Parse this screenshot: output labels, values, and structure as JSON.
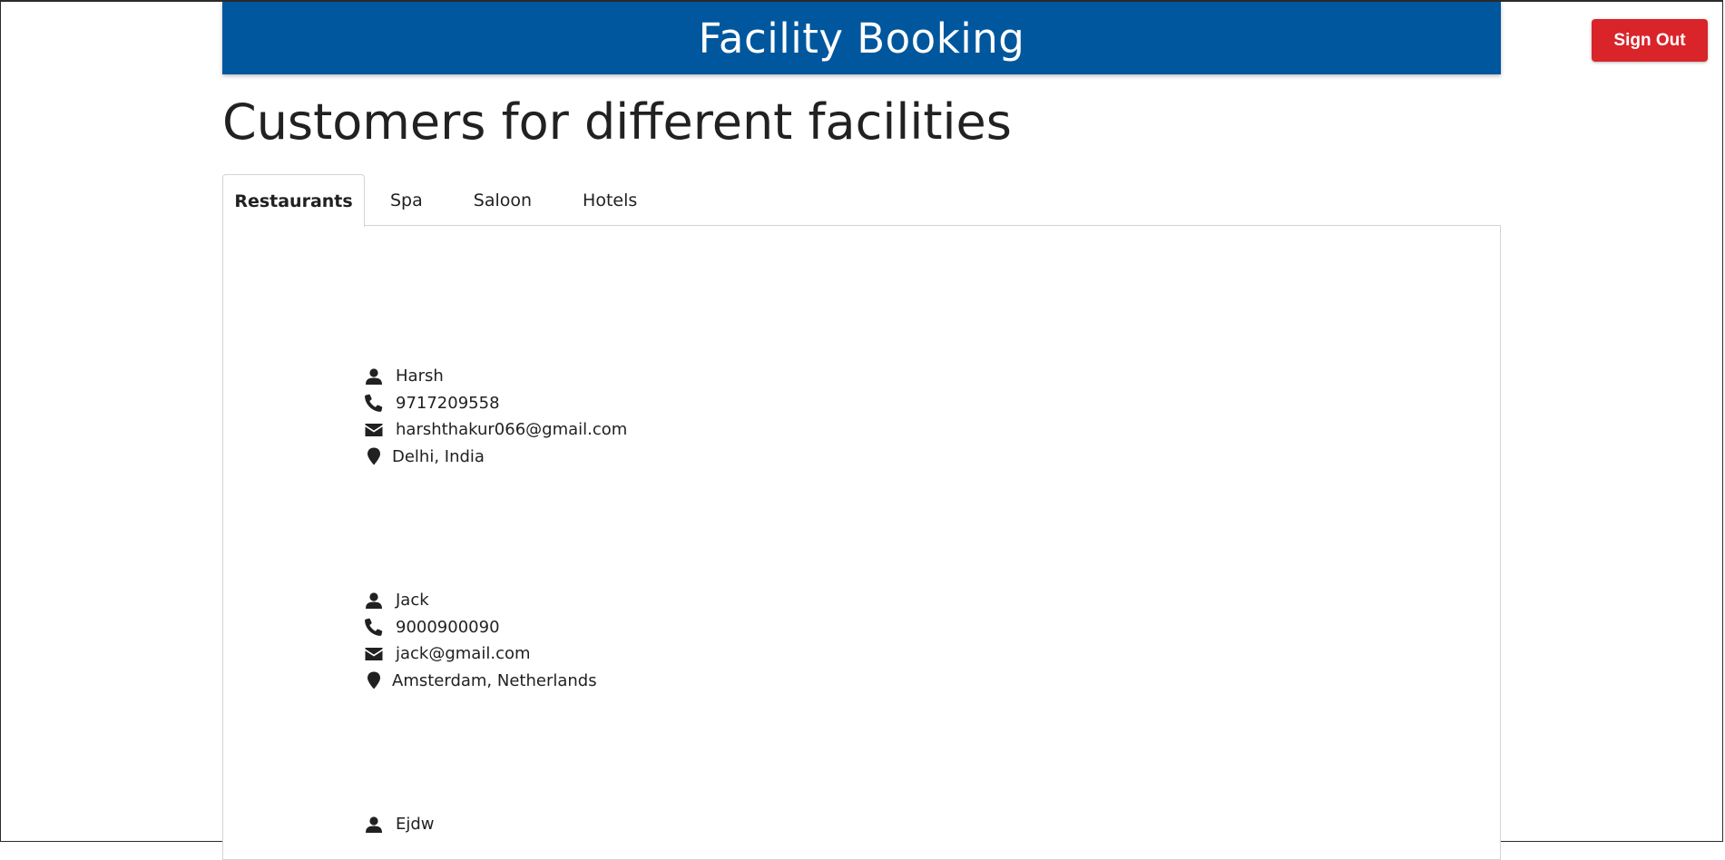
{
  "header": {
    "title": "Facility Booking",
    "sign_out_label": "Sign Out"
  },
  "page": {
    "title": "Customers for different facilities"
  },
  "tabs": [
    {
      "label": "Restaurants",
      "active": true
    },
    {
      "label": "Spa",
      "active": false
    },
    {
      "label": "Saloon",
      "active": false
    },
    {
      "label": "Hotels",
      "active": false
    }
  ],
  "customers": [
    {
      "name": "Harsh",
      "phone": "9717209558",
      "email": "harshthakur066@gmail.com",
      "location": "Delhi, India"
    },
    {
      "name": "Jack",
      "phone": "9000900090",
      "email": "jack@gmail.com",
      "location": "Amsterdam, Netherlands"
    },
    {
      "name": "Ejdw"
    }
  ],
  "icons": {
    "name": "user-icon",
    "phone": "phone-icon",
    "email": "envelope-icon",
    "location": "map-marker-icon"
  },
  "colors": {
    "header_bg": "#00579d",
    "sign_out_bg": "#d9242a",
    "text": "#212121"
  }
}
